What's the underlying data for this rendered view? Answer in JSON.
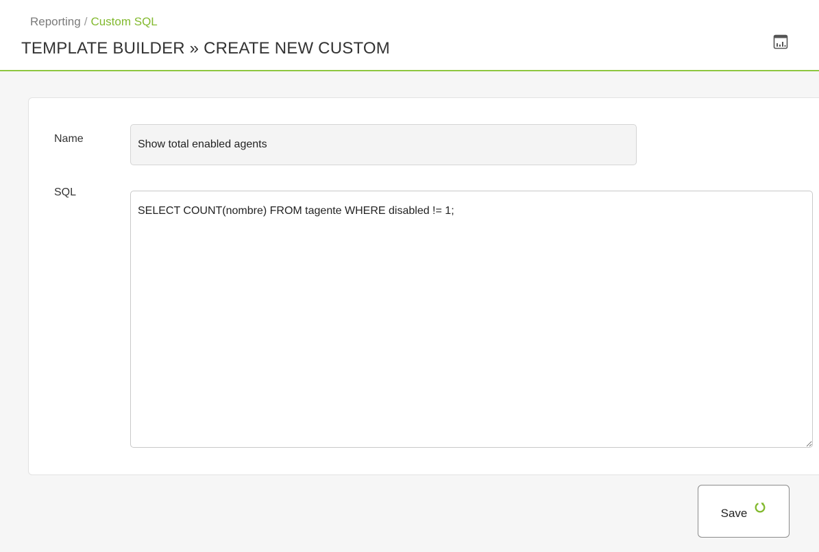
{
  "breadcrumb": {
    "root": "Reporting",
    "separator": "/",
    "current": "Custom SQL"
  },
  "page": {
    "title": "TEMPLATE BUILDER » CREATE NEW CUSTOM"
  },
  "header_actions": {
    "view_icon": "report-view-icon"
  },
  "form": {
    "name_label": "Name",
    "name_value": "Show total enabled agents",
    "sql_label": "SQL",
    "sql_value": "SELECT COUNT(nombre) FROM tagente WHERE disabled != 1;"
  },
  "actions": {
    "save_label": "Save",
    "save_icon": "refresh-icon"
  },
  "colors": {
    "accent": "#82b92e",
    "header_rule": "#8dc63f"
  }
}
